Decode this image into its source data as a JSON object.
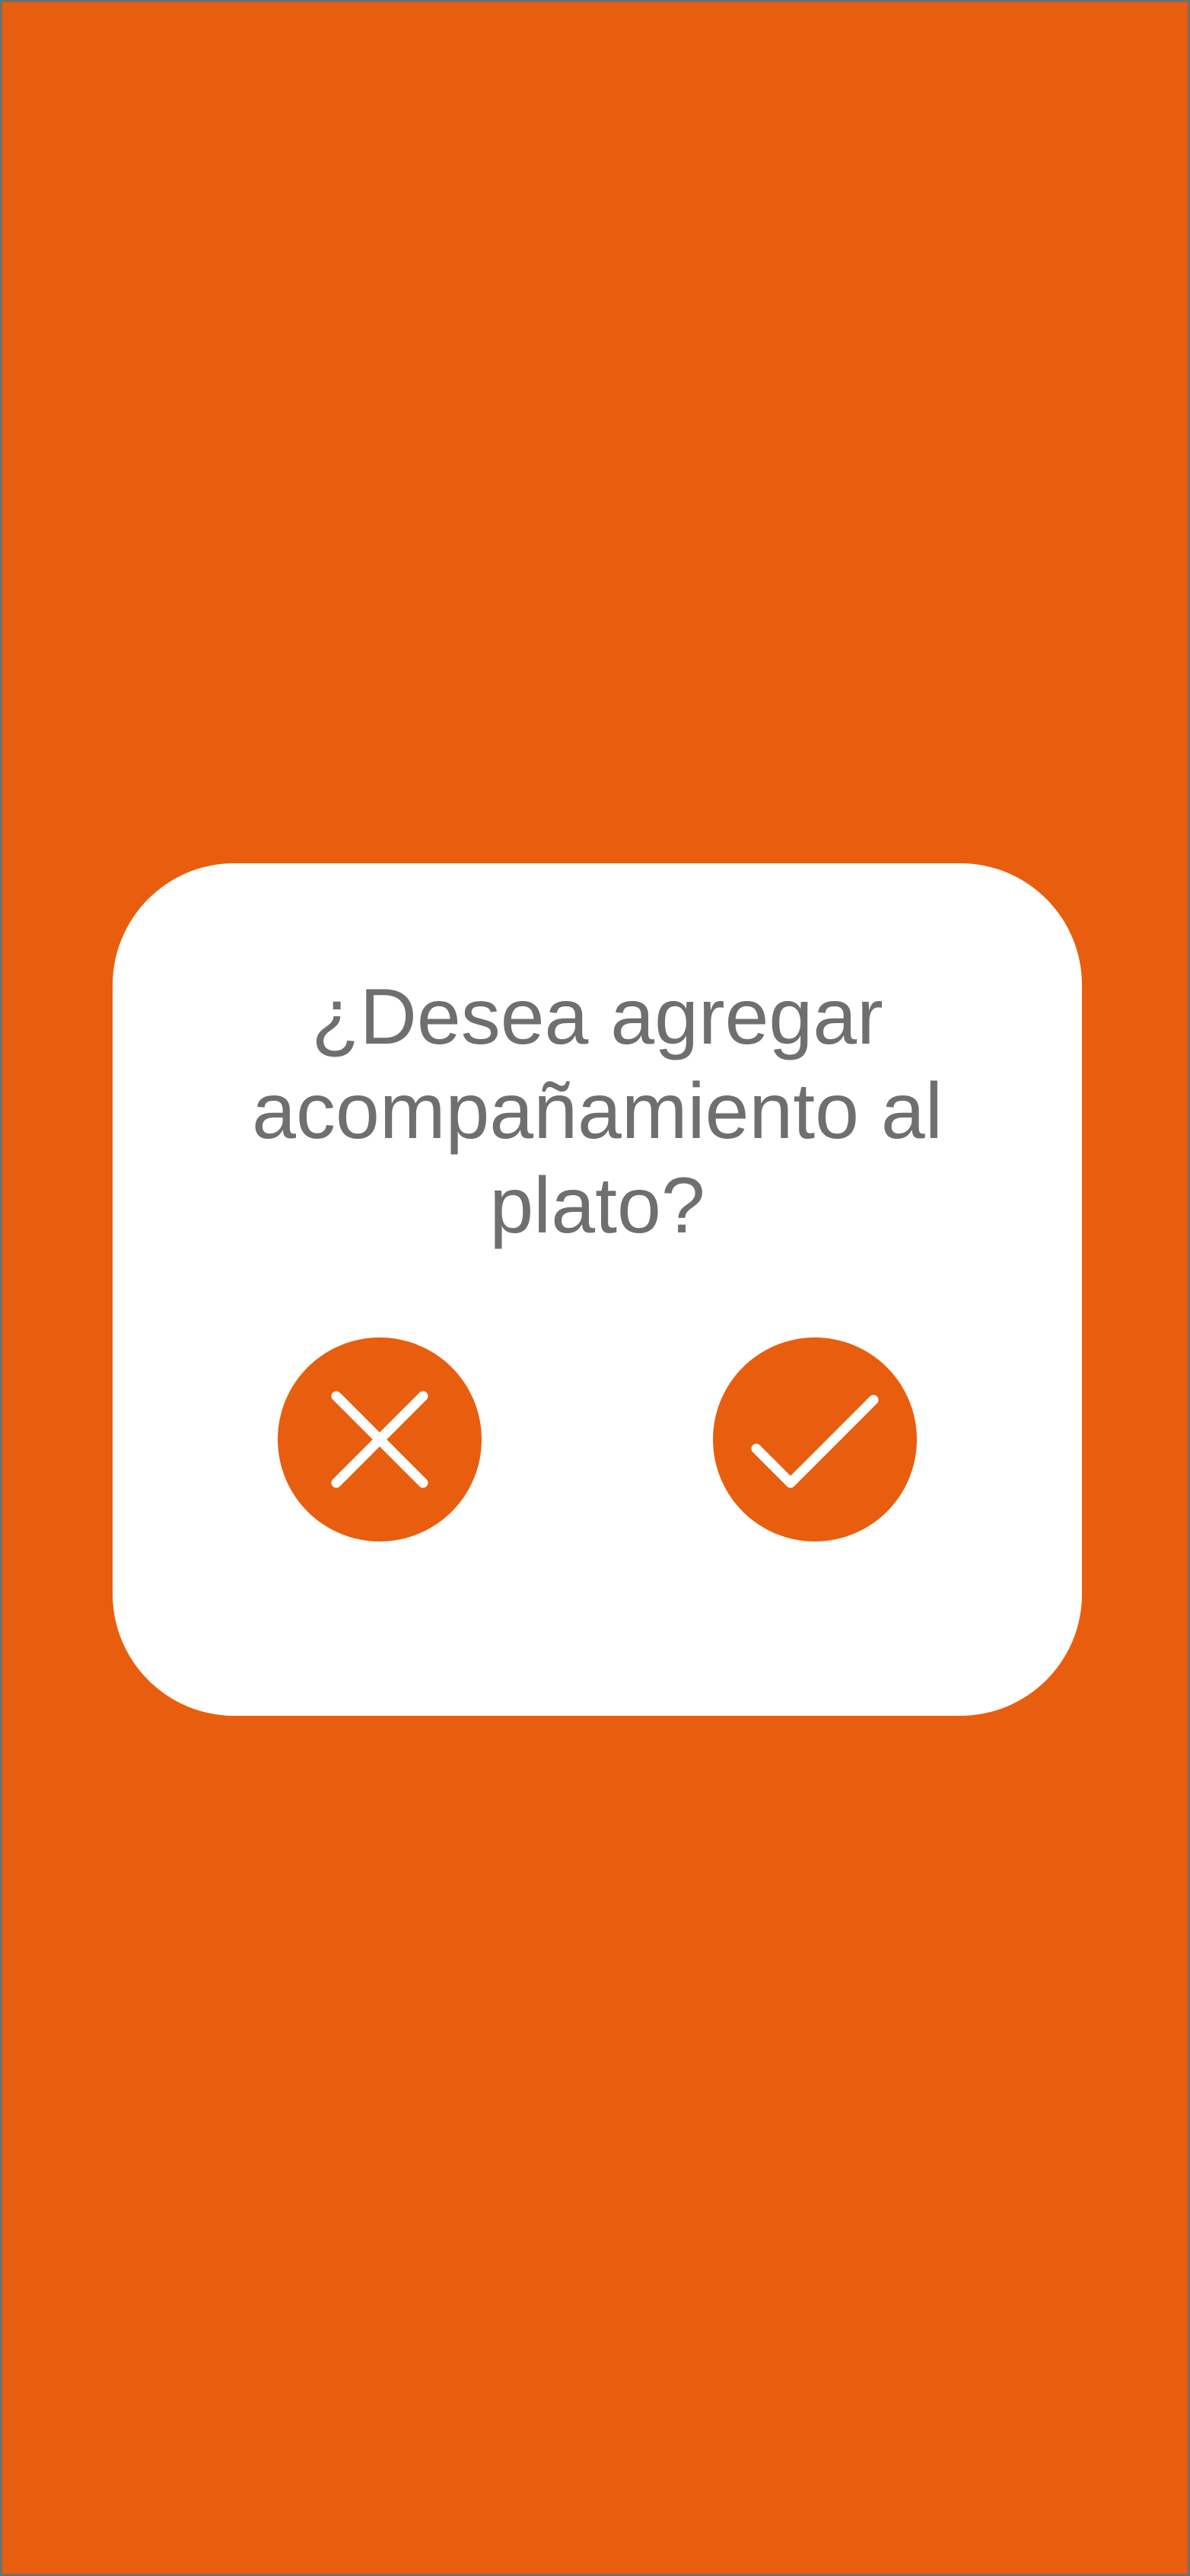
{
  "colors": {
    "background": "#e85e0e",
    "dialog": "#ffffff",
    "text": "#6f6f6f",
    "button": "#e85e0e",
    "button_icon": "#ffffff",
    "frame_border": "#6f6f6f"
  },
  "dialog": {
    "message": "¿Desea agregar acompañamiento al plato?",
    "cancel": {
      "icon": "close-icon",
      "aria_label": "No"
    },
    "confirm": {
      "icon": "check-icon",
      "aria_label": "Sí"
    }
  }
}
